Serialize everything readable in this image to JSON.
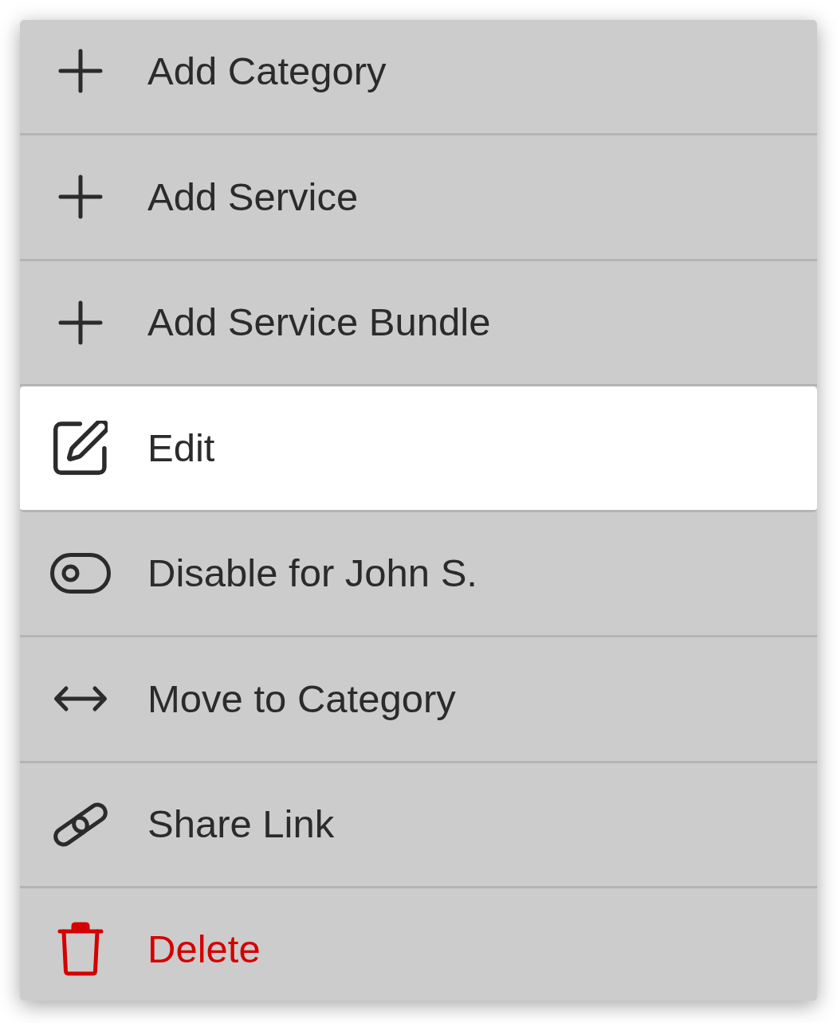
{
  "menu": {
    "items": [
      {
        "kind": "add",
        "label": "Add Category",
        "selected": false
      },
      {
        "kind": "add",
        "label": "Add Service",
        "selected": false
      },
      {
        "kind": "add",
        "label": "Add Service Bundle",
        "selected": false
      },
      {
        "kind": "edit",
        "label": "Edit",
        "selected": true
      },
      {
        "kind": "toggle",
        "label": "Disable for John S.",
        "selected": false
      },
      {
        "kind": "move",
        "label": "Move to Category",
        "selected": false
      },
      {
        "kind": "share",
        "label": "Share Link",
        "selected": false
      },
      {
        "kind": "delete",
        "label": "Delete",
        "selected": false
      }
    ]
  }
}
